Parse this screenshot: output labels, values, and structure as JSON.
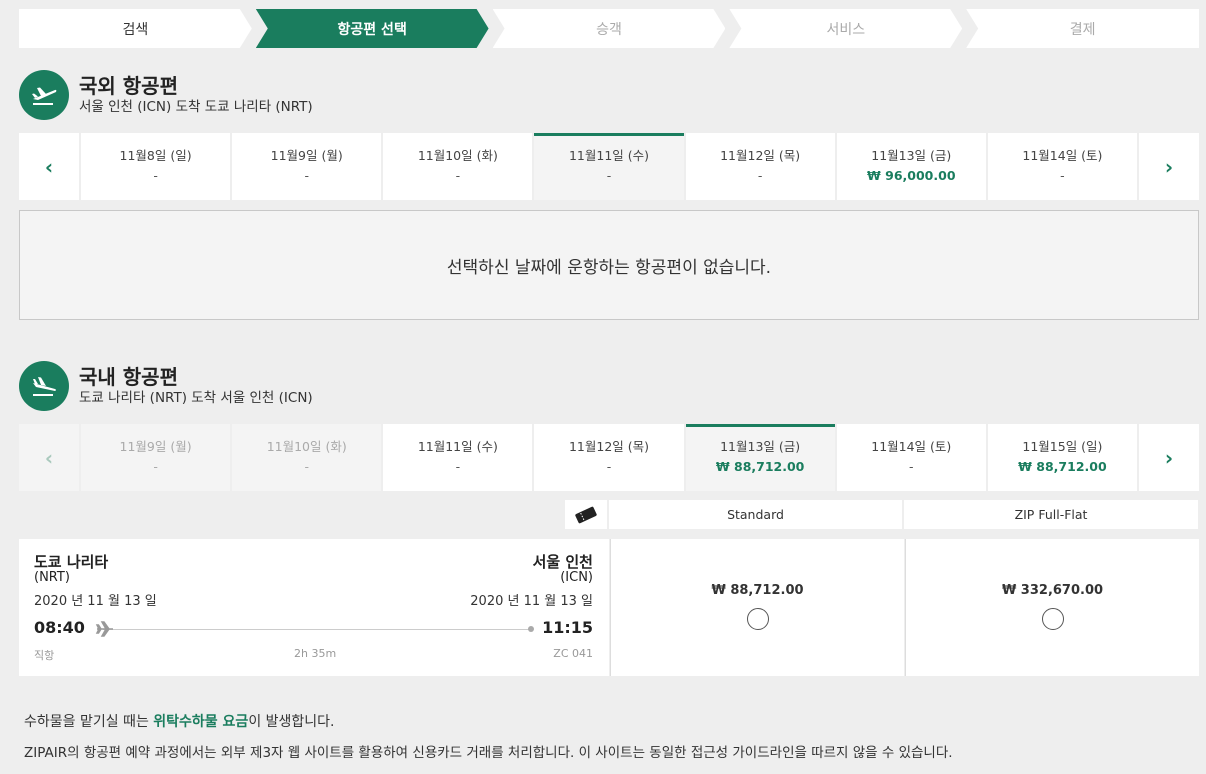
{
  "stepper": [
    "검색",
    "항공편 선택",
    "승객",
    "서비스",
    "결제"
  ],
  "outbound": {
    "title": "국외 항공편",
    "subtitle": "서울 인천 (ICN) 도착 도쿄 나리타 (NRT)",
    "dates": [
      {
        "label": "11월8일 (일)",
        "price": "-"
      },
      {
        "label": "11월9일 (월)",
        "price": "-"
      },
      {
        "label": "11월10일 (화)",
        "price": "-"
      },
      {
        "label": "11월11일 (수)",
        "price": "-"
      },
      {
        "label": "11월12일 (목)",
        "price": "-"
      },
      {
        "label": "11월13일 (금)",
        "price": "₩ 96,000.00"
      },
      {
        "label": "11월14일 (토)",
        "price": "-"
      }
    ],
    "empty_message": "선택하신 날짜에 운항하는 항공편이 없습니다."
  },
  "inbound": {
    "title": "국내 항공편",
    "subtitle": "도쿄 나리타 (NRT) 도착 서울 인천 (ICN)",
    "dates": [
      {
        "label": "11월9일 (월)",
        "price": "-"
      },
      {
        "label": "11월10일 (화)",
        "price": "-"
      },
      {
        "label": "11월11일 (수)",
        "price": "-"
      },
      {
        "label": "11월12일 (목)",
        "price": "-"
      },
      {
        "label": "11월13일 (금)",
        "price": "₩ 88,712.00"
      },
      {
        "label": "11월14일 (토)",
        "price": "-"
      },
      {
        "label": "11월15일 (일)",
        "price": "₩ 88,712.00"
      }
    ]
  },
  "fare_headers": [
    "Standard",
    "ZIP Full-Flat"
  ],
  "flight": {
    "dep_city": "도쿄 나리타",
    "dep_code": "(NRT)",
    "dep_date": "2020 년 11 월 13 일",
    "dep_time": "08:40",
    "arr_city": "서울 인천",
    "arr_code": "(ICN)",
    "arr_date": "2020 년 11 월 13 일",
    "arr_time": "11:15",
    "type": "직항",
    "duration": "2h 35m",
    "flight_no": "ZC 041",
    "fares": [
      "₩ 88,712.00",
      "₩ 332,670.00"
    ]
  },
  "notes": {
    "line1_pre": "수하물을 맡기실 때는 ",
    "line1_link": "위탁수하물 요금",
    "line1_post": "이 발생합니다.",
    "line2": "ZIPAIR의 항공편 예약 과정에서는 외부 제3자 웹 사이트를 활용하여 신용카드 거래를 처리합니다. 이 사이트는 동일한 접근성 가이드라인을 따르지 않을 수 있습니다."
  },
  "colors": {
    "brand": "#1a7d5e"
  }
}
